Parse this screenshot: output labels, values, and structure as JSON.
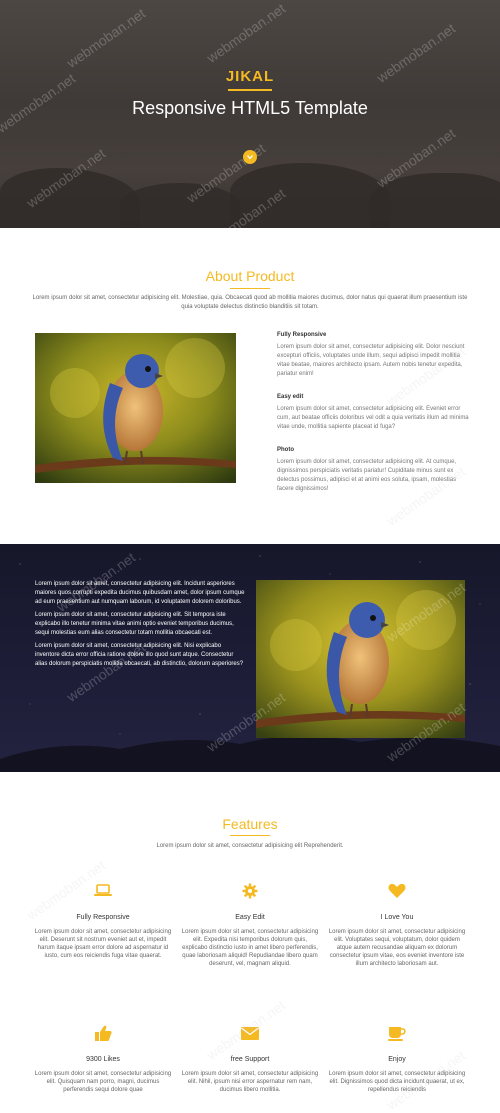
{
  "hero": {
    "brand": "JIKAL",
    "title": "Responsive HTML5 Template",
    "scroll_icon": "chevron-down-icon"
  },
  "watermark": "webmoban.net",
  "about": {
    "title": "About Product",
    "description": "Lorem ipsum dolor sit amet, consectetur adipisicing elit. Molestiae, quia. Obcaecati quod ab mollitia maiores ducimus, dolor natus qui quaerat illum praesentium iste quia voluptate delectus distinctio blanditiis sit totam.",
    "features": [
      {
        "title": "Fully Responsive",
        "text": "Lorem ipsum dolor sit amet, consectetur adipisicing elit. Dolor nesciunt excepturi officiis, voluptates unde illum, sequi adipisci impedit mollitia vitae beatae, maiores architecto ipsam. Autem nobis tenetur expedita, pariatur enim!"
      },
      {
        "title": "Easy edit",
        "text": "Lorem ipsum dolor sit amet, consectetur adipisicing elit. Eveniet error cum, aut beatae officiis doloribus vel odit a quia veritatis illum ad minima vitae unde, mollitia sapiente placeat id fuga?"
      },
      {
        "title": "Photo",
        "text": "Lorem ipsum dolor sit amet, consectetur adipisicing elit. At cumque, dignissimos perspiciatis veritatis pariatur! Cupiditate minus sunt ex delectus possimus, adipisci et at animi eos soluta, ipsam, molestias facere dignissimos!"
      }
    ]
  },
  "dark": {
    "paragraphs": [
      "Lorem ipsum dolor sit amet, consectetur adipisicing elit. Incidunt asperiores maiores quos corrupti expedita ducimus quibusdam amet, dolor ipsum cumque ad eum praesentium aut numquam laborum, id voluptatem dolorem doloribus.",
      "Lorem ipsum dolor sit amet, consectetur adipisicing elit. Sit tempora iste explicabo illo tenetur minima vitae animi optio eveniet temporibus ducimus, sequi molestias eum alias consectetur totam mollitia obcaecati est.",
      "Lorem ipsum dolor sit amet, consectetur adipisicing elit. Nisi explicabo inventore dicta error officia ratione dolore illo quod sunt atque. Consectetur alias dolorum perspiciatis mollitia obcaecati, ab distinctio, dolorum asperiores?"
    ]
  },
  "features": {
    "title": "Features",
    "description": "Lorem ipsum dolor sit amet, consectetur adipisicing elit Reprehenderit.",
    "accent": "#f5b921",
    "items": [
      {
        "icon": "laptop-icon",
        "title": "Fully Responsive",
        "text": "Lorem ipsum dolor sit amet, consectetur adipisicing elit. Deserunt sit nostrum eveniet aut et, impedit harum itaque ipsam error dolore ad aspernatur id iusto, cum eos reiciendis fuga vitae quaerat."
      },
      {
        "icon": "gear-icon",
        "title": "Easy Edit",
        "text": "Lorem ipsum dolor sit amet, consectetur adipisicing elit. Expedita nisi temporibus dolorum quis, explicabo distinctio iusto in amet libero perferendis, quae laboriosam aliquid! Repudiandae libero quam deserunt, vel, magnam aliquid."
      },
      {
        "icon": "heart-icon",
        "title": "I Love You",
        "text": "Lorem ipsum dolor sit amet, consectetur adipisicing elit. Voluptates sequi, voluptatum, dolor quidem atque autem recusandae aliquam ex dolorum consectetur ipsum vitae, eos eveniet inventore iste illum architecto laboriosam aut."
      },
      {
        "icon": "thumbs-up-icon",
        "title": "9300 Likes",
        "text": "Lorem ipsum dolor sit amet, consectetur adipisicing elit. Quisquam nam porro, magni, ducimus perferendis sequi dolore quae"
      },
      {
        "icon": "envelope-icon",
        "title": "free Support",
        "text": "Lorem ipsum dolor sit amet, consectetur adipisicing elit. Nihil, ipsum nisi error aspernatur rem nam, ducimus libero mollitia."
      },
      {
        "icon": "coffee-cup-icon",
        "title": "Enjoy",
        "text": "Lorem ipsum dolor sit amet, consectetur adipisicing elit. Dignissimos quod dicta incidunt quaerat, ut ex, repellendus reiciendis"
      }
    ]
  }
}
